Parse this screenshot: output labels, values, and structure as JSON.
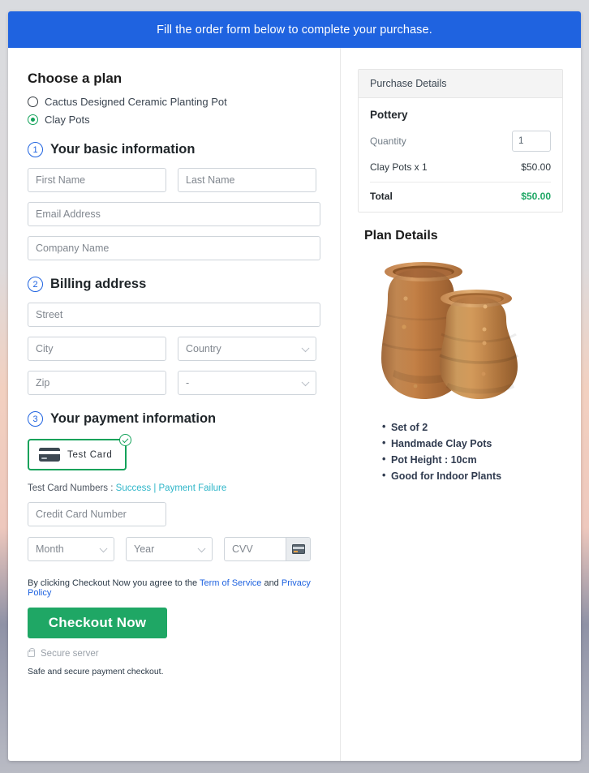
{
  "banner": {
    "text": "Fill the order form below to complete your purchase."
  },
  "plan": {
    "heading": "Choose a plan",
    "options": [
      {
        "label": "Cactus Designed Ceramic Planting Pot",
        "selected": false
      },
      {
        "label": "Clay Pots",
        "selected": true
      }
    ]
  },
  "steps": {
    "one": {
      "number": "1",
      "title": "Your basic information"
    },
    "two": {
      "number": "2",
      "title": "Billing address"
    },
    "three": {
      "number": "3",
      "title": "Your payment information"
    }
  },
  "basic_info": {
    "first_name_placeholder": "First Name",
    "first_name_value": "",
    "last_name_placeholder": "Last Name",
    "last_name_value": "",
    "email_placeholder": "Email Address",
    "email_value": "",
    "company_placeholder": "Company Name",
    "company_value": ""
  },
  "billing": {
    "street_placeholder": "Street",
    "street_value": "",
    "city_placeholder": "City",
    "city_value": "",
    "country_selected": "Country",
    "state_selected": "-"
  },
  "payment": {
    "test_card_label": "Test  Card",
    "card_icon": "credit-card-icon",
    "selected_badge": "check-circle-icon",
    "test_numbers_prefix": "Test Card Numbers : ",
    "success_link": "Success",
    "separator": " | ",
    "failure_link": "Payment Failure",
    "card_number_placeholder": "Credit Card Number",
    "card_number_value": "",
    "month_selected": "Month",
    "year_selected": "Year",
    "cvv_placeholder": "CVV",
    "cvv_value": "",
    "cvv_icon": "credit-card-icon"
  },
  "footer": {
    "terms_prefix": "By clicking Checkout Now you agree to the ",
    "terms_link": "Term of Service",
    "terms_middle": " and ",
    "privacy_link": "Privacy Policy",
    "checkout_label": "Checkout Now",
    "secure_icon": "lock-icon",
    "secure_text": "Secure server",
    "safe_text": "Safe and secure payment checkout."
  },
  "purchase": {
    "header": "Purchase Details",
    "product_name": "Pottery",
    "quantity_label": "Quantity",
    "quantity_value": "1",
    "line_item_label": "Clay Pots x 1",
    "line_item_price": "$50.00",
    "total_label": "Total",
    "total_value": "$50.00"
  },
  "plan_details": {
    "title": "Plan Details",
    "image_alt": "two-clay-pots-image",
    "features": [
      "Set of 2",
      "Handmade Clay Pots",
      "Pot Height : 10cm",
      "Good for Indoor Plants"
    ]
  },
  "colors": {
    "banner_blue": "#1f63e0",
    "accent_green": "#1fa765",
    "link_blue": "#1f63e0",
    "link_teal": "#2fb6c9",
    "step_blue": "#1f63e0"
  }
}
